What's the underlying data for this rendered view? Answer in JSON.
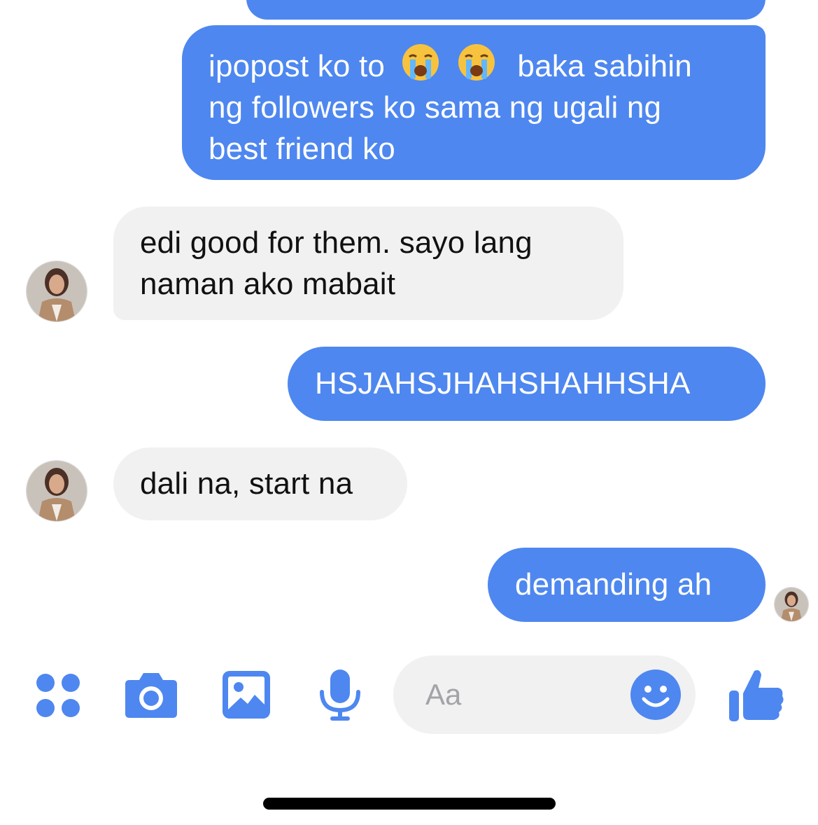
{
  "colors": {
    "accent": "#4e87ef",
    "received_bubble": "#f1f1f2",
    "placeholder": "#a3a3a8"
  },
  "messages": [
    {
      "sender": "me",
      "text": ""
    },
    {
      "sender": "me",
      "text_before_emoji": "ipopost ko to",
      "emoji": [
        "loudly-crying-face",
        "loudly-crying-face"
      ],
      "text_after_emoji": "baka sabihin",
      "text_line2": "ng followers ko sama ng ugali ng",
      "text_line3": "best friend ko"
    },
    {
      "sender": "friend",
      "text_line1": "edi good for them. sayo lang",
      "text_line2": "naman ako mabait"
    },
    {
      "sender": "me",
      "text": "HSJAHSJHAHSHAHHSHA"
    },
    {
      "sender": "friend",
      "text": "dali na, start na"
    },
    {
      "sender": "me",
      "text": "demanding ah"
    }
  ],
  "composer": {
    "icons": [
      "apps-icon",
      "camera-icon",
      "image-icon",
      "microphone-icon",
      "emoji-icon",
      "like-icon"
    ],
    "placeholder": "Aa"
  }
}
